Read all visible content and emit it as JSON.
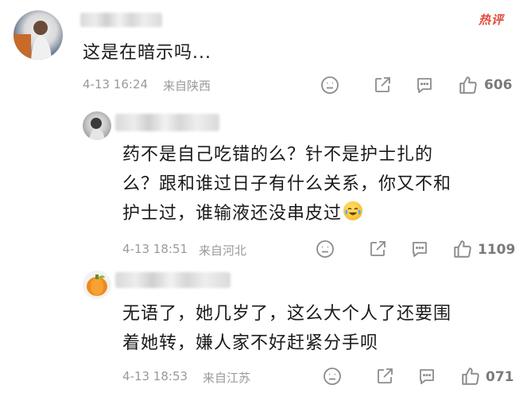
{
  "badge": {
    "hot_label": "热评"
  },
  "comments": [
    {
      "text_lines": [
        "这是在暗示吗..."
      ],
      "time": "4-13 16:24",
      "location": "来自陕西",
      "likes": "606"
    },
    {
      "text_lines": [
        "药不是自己吃错的么？针不是护士扎的",
        "么？跟和谁过日子有什么关系，你又不和",
        "护士过，谁输液还没串皮过"
      ],
      "emoji": "laugh-cry-emoji",
      "time": "4-13 18:51",
      "location": "来自河北",
      "likes": "1109"
    },
    {
      "text_lines": [
        "无语了，她几岁了，这么大个人了还要围",
        "着她转，嫌人家不好赶紧分手呗"
      ],
      "time": "4-13 18:53",
      "location": "来自江苏",
      "likes": "071"
    }
  ],
  "icons": [
    "emoji-icon",
    "share-icon",
    "comment-icon",
    "thumbs-up-icon"
  ],
  "colors": {
    "hot": "#e24a3b",
    "meta": "#9a9a9a",
    "text": "#1a1a1a"
  }
}
